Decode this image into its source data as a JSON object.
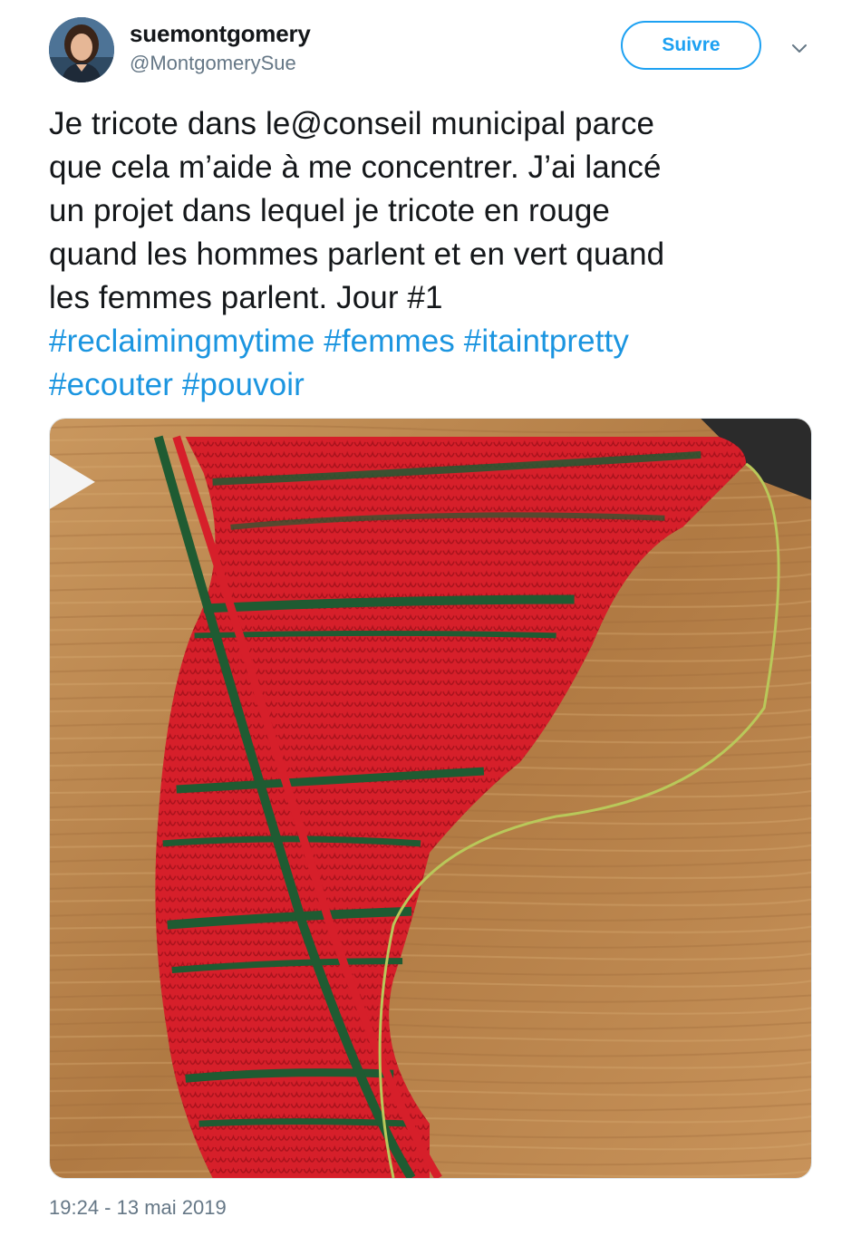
{
  "author": {
    "display_name": "suemontgomery",
    "handle": "@MontgomerySue",
    "avatar_icon": "avatar-photo"
  },
  "follow_button": {
    "label": "Suivre"
  },
  "more_menu": {
    "icon": "chevron-down-icon"
  },
  "tweet": {
    "text_line1": "Je tricote dans le@conseil municipal parce",
    "text_line2": "que cela m’aide à me concentrer. J’ai lancé",
    "text_line3": "un projet dans lequel je tricote en rouge",
    "text_line4": "quand les hommes parlent et en vert quand",
    "text_line5": "les femmes parlent. Jour #1",
    "hashtags": [
      "#reclaimingmytime",
      "#femmes",
      "#itaintpretty",
      "#ecouter",
      "#pouvoir"
    ],
    "timestamp": "19:24 - 13 mai 2019"
  },
  "photo": {
    "description_icon": "knitting-photo"
  },
  "colors": {
    "accent": "#1da1f2",
    "hashtag": "#1b95e0",
    "secondary_text": "#657786",
    "knit_red": "#d8202a",
    "knit_green": "#1f5b32",
    "wood": "#b8824a"
  }
}
